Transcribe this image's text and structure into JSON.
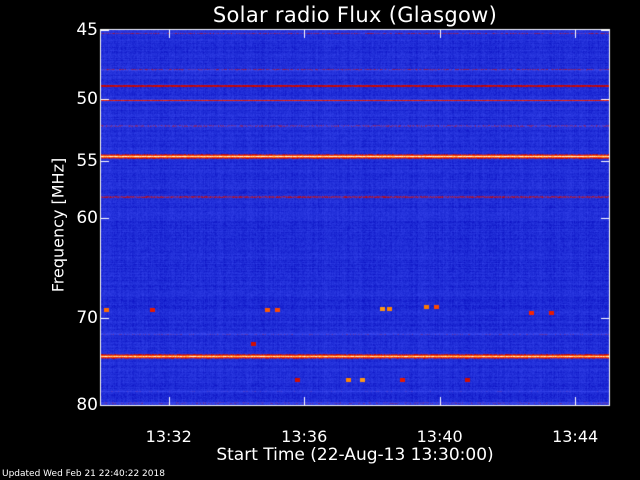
{
  "chart_data": {
    "type": "heatmap",
    "title": "Solar radio Flux (Glasgow)",
    "xlabel": "Start Time (22-Aug-13 13:30:00)",
    "ylabel": "Frequency [MHz]",
    "x_unit": "minutes after 13:30:00",
    "xlim": [
      0,
      15
    ],
    "ylim": [
      45,
      80
    ],
    "y_ticks": [
      {
        "value": 45,
        "label": "45"
      },
      {
        "value": 50,
        "label": "50"
      },
      {
        "value": 55,
        "label": "55"
      },
      {
        "value": 60,
        "label": "60"
      },
      {
        "value": 70,
        "label": "70"
      },
      {
        "value": 80,
        "label": "80"
      }
    ],
    "x_ticks": [
      {
        "value": 2,
        "label": "13:32"
      },
      {
        "value": 6,
        "label": "13:36"
      },
      {
        "value": 10,
        "label": "13:40"
      },
      {
        "value": 14,
        "label": "13:44"
      }
    ],
    "colormap": [
      "#0000b8",
      "#1e2cd6",
      "#3a48ee",
      "#c00000",
      "#ff2800",
      "#ff8c00",
      "#ffffe0"
    ],
    "background_color": "#1a28c8",
    "emission_bands_mhz": [
      {
        "freq": 45.2,
        "intensity": 0.42
      },
      {
        "freq": 47.8,
        "intensity": 0.48
      },
      {
        "freq": 49.0,
        "intensity": 0.7
      },
      {
        "freq": 50.1,
        "intensity": 0.62
      },
      {
        "freq": 52.1,
        "intensity": 0.5
      },
      {
        "freq": 54.6,
        "intensity": 0.98
      },
      {
        "freq": 58.1,
        "intensity": 0.58
      },
      {
        "freq": 71.7,
        "intensity": 0.42
      },
      {
        "freq": 74.2,
        "intensity": 0.96
      },
      {
        "freq": 78.3,
        "intensity": 0.3
      },
      {
        "freq": 79.7,
        "intensity": 0.45
      }
    ],
    "bursts": [
      {
        "t": 0.15,
        "freq": 69.2,
        "intensity": 0.78
      },
      {
        "t": 1.5,
        "freq": 69.2,
        "intensity": 0.6
      },
      {
        "t": 4.9,
        "freq": 69.2,
        "intensity": 0.75
      },
      {
        "t": 5.2,
        "freq": 69.2,
        "intensity": 0.72
      },
      {
        "t": 8.3,
        "freq": 69.0,
        "intensity": 0.85
      },
      {
        "t": 8.5,
        "freq": 69.0,
        "intensity": 0.82
      },
      {
        "t": 9.6,
        "freq": 68.8,
        "intensity": 0.8
      },
      {
        "t": 9.9,
        "freq": 68.8,
        "intensity": 0.72
      },
      {
        "t": 12.7,
        "freq": 69.5,
        "intensity": 0.65
      },
      {
        "t": 13.3,
        "freq": 69.5,
        "intensity": 0.6
      },
      {
        "t": 4.5,
        "freq": 72.8,
        "intensity": 0.55
      },
      {
        "t": 5.8,
        "freq": 77.0,
        "intensity": 0.55
      },
      {
        "t": 7.3,
        "freq": 77.0,
        "intensity": 0.82
      },
      {
        "t": 7.7,
        "freq": 77.0,
        "intensity": 0.85
      },
      {
        "t": 8.9,
        "freq": 77.0,
        "intensity": 0.6
      },
      {
        "t": 10.8,
        "freq": 77.0,
        "intensity": 0.55
      }
    ]
  },
  "footer": {
    "updated": "Updated Wed Feb 21 22:40:22 2018"
  }
}
